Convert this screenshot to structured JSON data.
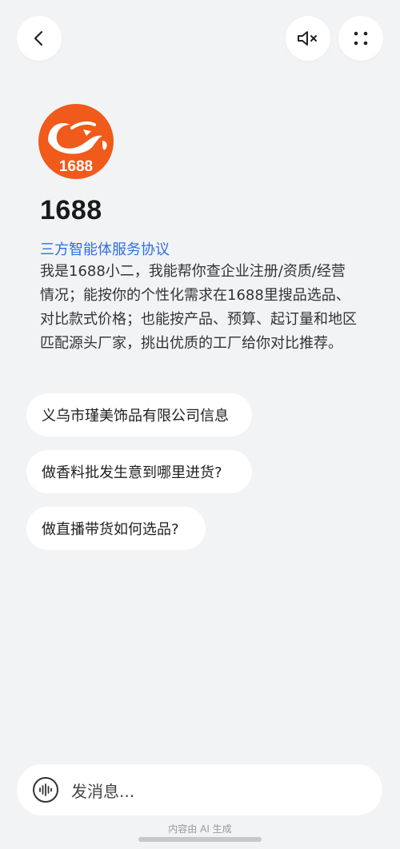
{
  "header": {
    "back_icon": "chevron-left-icon",
    "mute_icon": "speaker-muted-icon",
    "more_icon": "four-dots-icon"
  },
  "agent": {
    "logo_text": "1688",
    "name": "1688",
    "agreement_link": "三方智能体服务协议",
    "intro": "我是1688小二，我能帮你查企业注册/资质/经营情况；能按你的个性化需求在1688里搜品选品、对比款式价格；也能按产品、预算、起订量和地区匹配源头厂家，挑出优质的工厂给你对比推荐。"
  },
  "suggestions": [
    {
      "label": "义乌市瑾美饰品有限公司信息"
    },
    {
      "label": "做香料批发生意到哪里进货?"
    },
    {
      "label": "做直播带货如何选品?"
    }
  ],
  "input": {
    "placeholder": "发消息...",
    "voice_icon": "voice-wave-icon"
  },
  "footer": {
    "disclaimer": "内容由 AI 生成"
  },
  "colors": {
    "background": "#f2f3f5",
    "brand_orange": "#f05a1a",
    "link_blue": "#2f6fe0"
  }
}
